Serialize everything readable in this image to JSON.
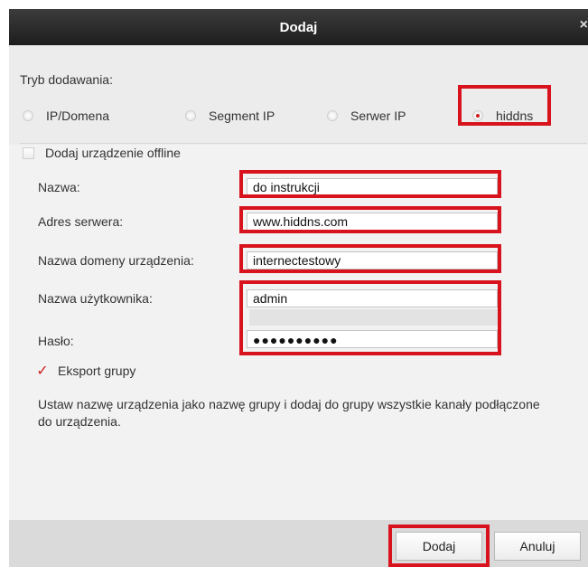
{
  "dialog": {
    "title": "Dodaj",
    "close_glyph": "×"
  },
  "mode": {
    "label": "Tryb dodawania:",
    "options": [
      {
        "label": "IP/Domena",
        "selected": false
      },
      {
        "label": "Segment IP",
        "selected": false
      },
      {
        "label": "Serwer IP",
        "selected": false
      },
      {
        "label": "hiddns",
        "selected": true
      }
    ]
  },
  "offline": {
    "label": "Dodaj urządzenie offline",
    "checked": false
  },
  "fields": {
    "name": {
      "label": "Nazwa:",
      "value": "do instrukcji"
    },
    "server": {
      "label": "Adres serwera:",
      "value": "www.hiddns.com"
    },
    "domain": {
      "label": "Nazwa domeny urządzenia:",
      "value": "internectestowy"
    },
    "username": {
      "label": "Nazwa użytkownika:",
      "value": "admin"
    },
    "password": {
      "label": "Hasło:",
      "value": "●●●●●●●●●●"
    }
  },
  "export_group": {
    "label": "Eksport grupy",
    "checked": true,
    "check_glyph": "✓"
  },
  "description": "Ustaw nazwę urządzenia jako nazwę grupy i dodaj do grupy wszystkie kanały podłączone do urządzenia.",
  "buttons": {
    "add": "Dodaj",
    "cancel": "Anuluj"
  },
  "colors": {
    "highlight_red": "#d8131d",
    "radio_selected": "#d21c1c",
    "titlebar": "#2a2a2a"
  }
}
